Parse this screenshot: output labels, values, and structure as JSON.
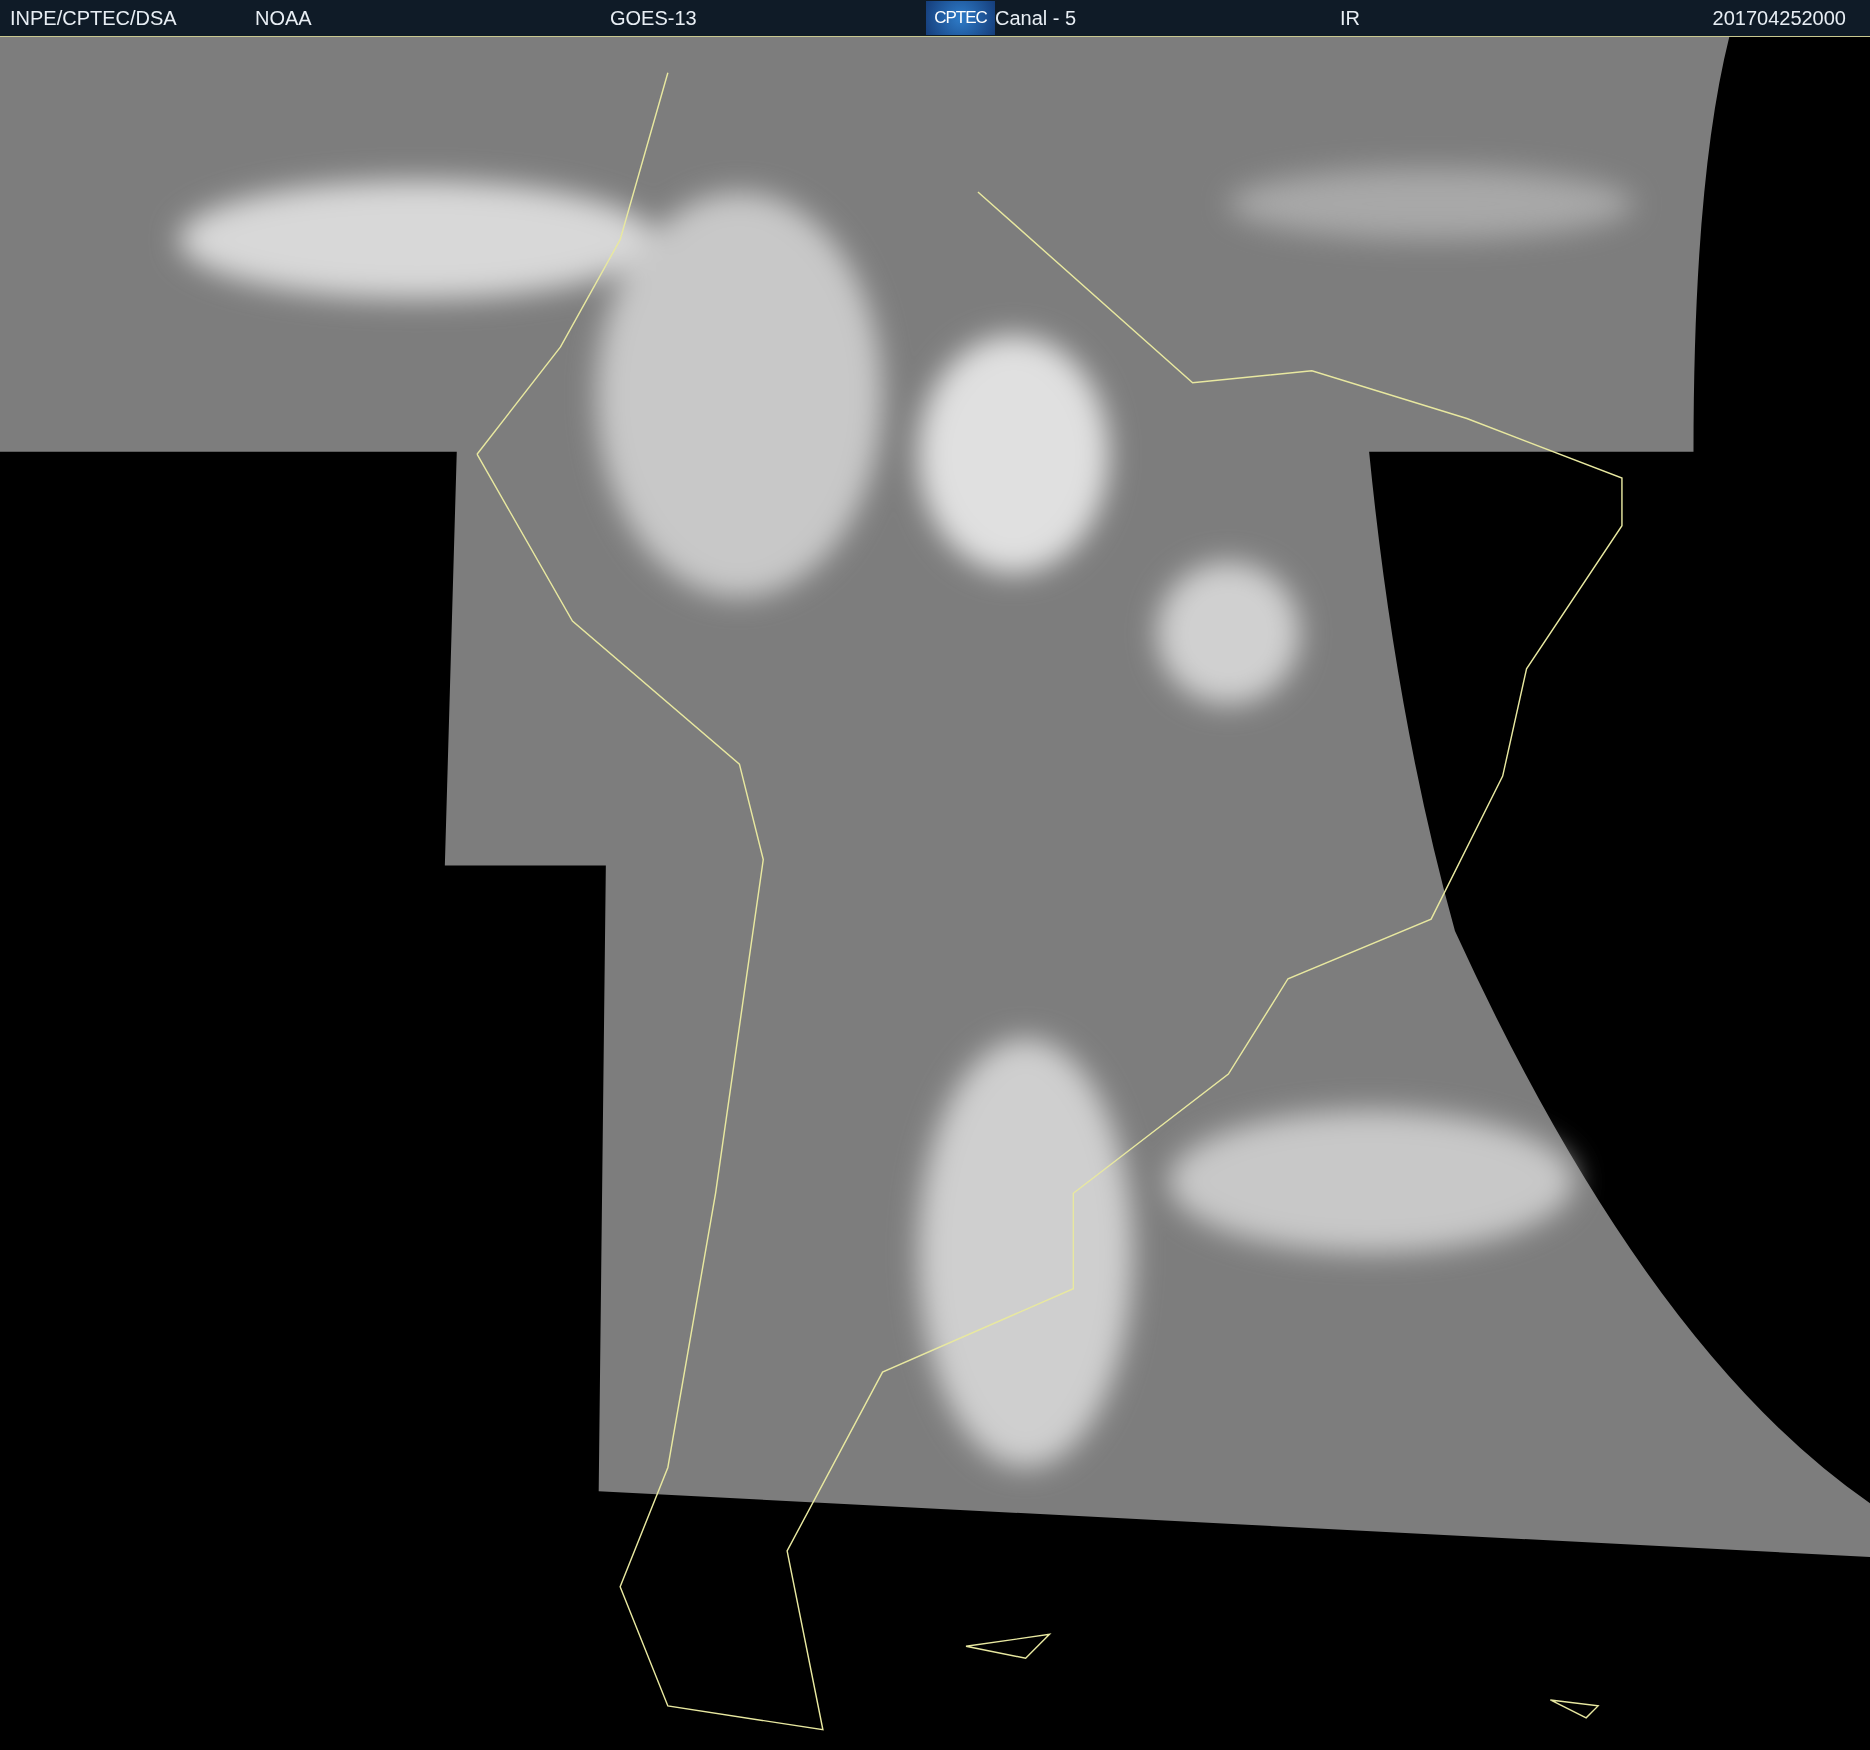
{
  "header": {
    "items": [
      {
        "kind": "text",
        "text": "INPE/CPTEC/DSA"
      },
      {
        "kind": "text",
        "text": "NOAA"
      },
      {
        "kind": "text",
        "text": "GOES-13"
      },
      {
        "kind": "logo",
        "text": "CPTEC"
      },
      {
        "kind": "text",
        "text": "Canal - 5"
      },
      {
        "kind": "text",
        "text": "IR"
      },
      {
        "kind": "text",
        "text": "201704252000"
      }
    ]
  }
}
